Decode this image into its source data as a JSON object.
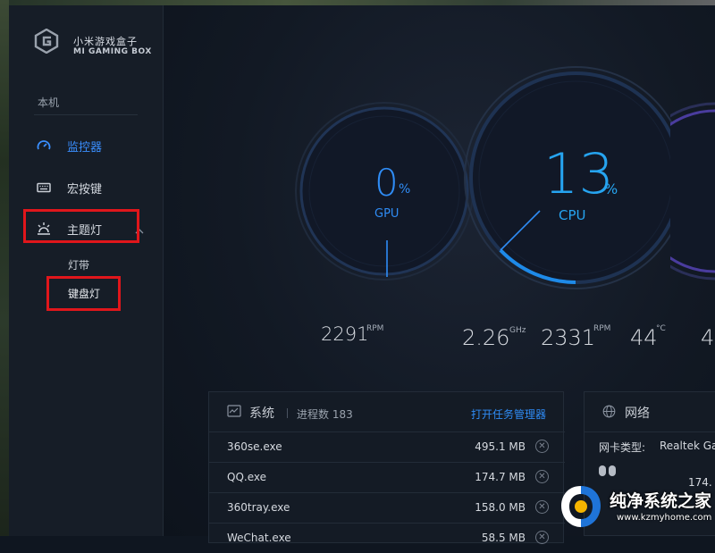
{
  "app": {
    "name_cn": "小米游戏盒子",
    "name_en": "MI GAMING BOX"
  },
  "sidebar": {
    "section": "本机",
    "items": [
      {
        "label": "监控器",
        "icon": "speedometer-icon",
        "active": true
      },
      {
        "label": "宏按键",
        "icon": "keyboard-icon",
        "active": false
      },
      {
        "label": "主题灯",
        "icon": "light-icon",
        "active": false,
        "expanded": true
      }
    ],
    "subitems": [
      "灯带",
      "键盘灯"
    ]
  },
  "gauges": {
    "gpu": {
      "value": "0",
      "percent_sign": "%",
      "label": "GPU",
      "load": 0
    },
    "cpu": {
      "value": "13",
      "percent_sign": "%",
      "label": "CPU",
      "load": 13
    }
  },
  "stats": {
    "gpu_fan": {
      "value": "2291",
      "unit": "RPM"
    },
    "cpu_freq": {
      "value": "2.26",
      "unit": "GHz"
    },
    "cpu_fan": {
      "value": "2331",
      "unit": "RPM"
    },
    "cpu_temp": {
      "value": "44",
      "unit": "°C"
    },
    "cut": {
      "value": "4."
    }
  },
  "system_panel": {
    "title": "系统",
    "process_label": "进程数 183",
    "task_manager": "打开任务管理器",
    "processes": [
      {
        "name": "360se.exe",
        "size": "495.1 MB"
      },
      {
        "name": "QQ.exe",
        "size": "174.7 MB"
      },
      {
        "name": "360tray.exe",
        "size": "158.0 MB"
      },
      {
        "name": "WeChat.exe",
        "size": "58.5 MB"
      }
    ],
    "close_glyph": "✕"
  },
  "network_panel": {
    "title": "网络",
    "nic_label": "网卡类型:",
    "nic_value": "Realtek Ga",
    "speed_partial": "174."
  },
  "watermark": {
    "site_cn": "纯净系统之家",
    "site_url": "www.kzmyhome.com"
  },
  "colors": {
    "accent": "#2f8cf5",
    "highlight_box": "#e0161b",
    "background": "#121924"
  }
}
